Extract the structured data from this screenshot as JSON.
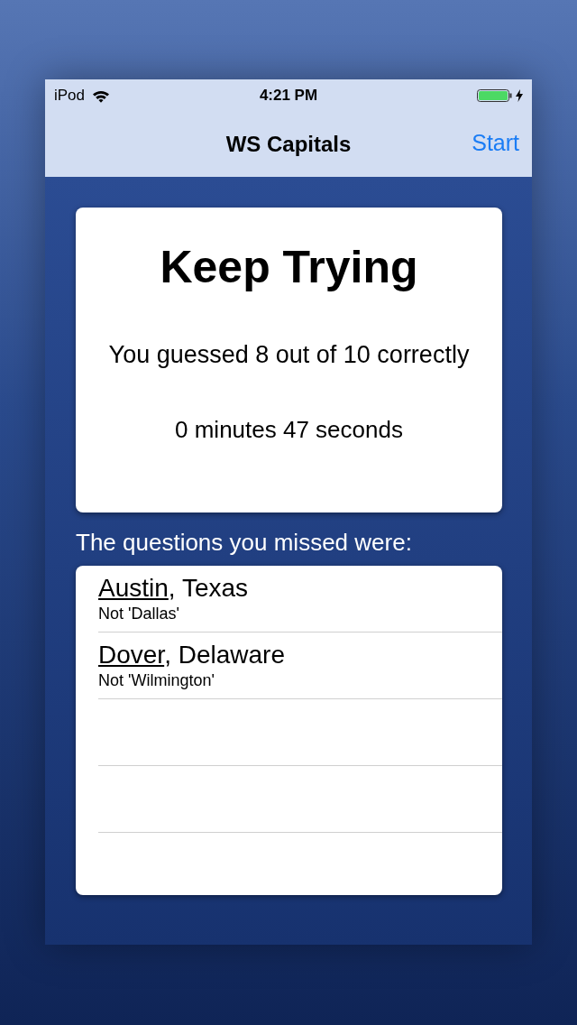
{
  "status_bar": {
    "carrier": "iPod",
    "time": "4:21 PM"
  },
  "nav_bar": {
    "title": "WS Capitals",
    "action": "Start"
  },
  "result": {
    "heading": "Keep Trying",
    "score": "You guessed 8 out of 10 correctly",
    "time": "0 minutes 47 seconds"
  },
  "missed_label": "The questions you missed were:",
  "missed": [
    {
      "capital": "Austin",
      "state": ", Texas",
      "answer": "Not 'Dallas'"
    },
    {
      "capital": "Dover",
      "state": ", Delaware",
      "answer": "Not 'Wilmington'"
    }
  ]
}
